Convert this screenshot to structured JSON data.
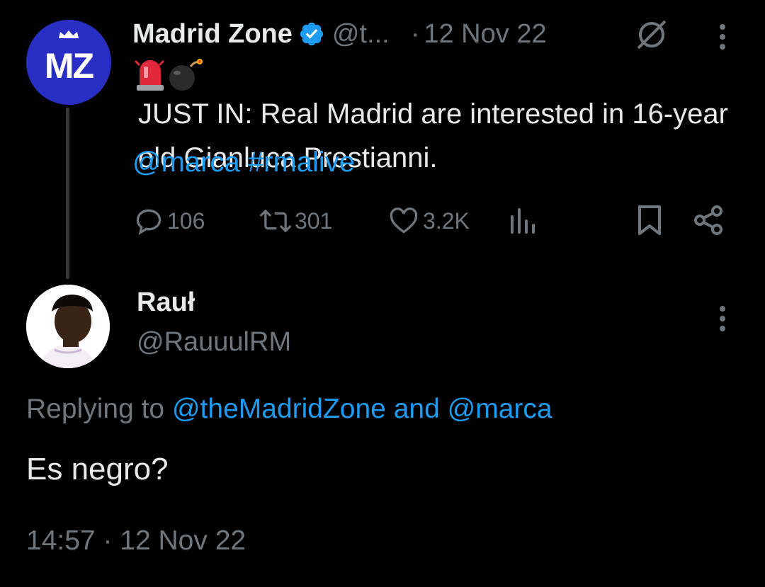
{
  "main_tweet": {
    "author_name": "Madrid Zone",
    "handle": "@t...",
    "separator": "·",
    "date": "12 Nov 22",
    "avatar_text": "MZ",
    "emojis": [
      "police-light",
      "bomb"
    ],
    "text": "JUST IN: Real Madrid are interested in 16-year old Gianluca Prestianni.",
    "mention": "@marca",
    "hashtag": "#rmalive",
    "replies": "106",
    "retweets": "301",
    "likes": "3.2K"
  },
  "reply": {
    "author_name": "Rauł",
    "handle": "@RauuulRM",
    "replying_prefix": "Replying to",
    "replying_to_1": "@theMadridZone",
    "replying_and": "and",
    "replying_to_2": "@marca",
    "text": "Es negro?",
    "time": "14:57",
    "separator": "·",
    "date": "12 Nov 22"
  },
  "colors": {
    "background": "#000000",
    "text": "#e7e9ea",
    "muted": "#71767b",
    "link": "#1d9bf0",
    "verified": "#1d9bf0",
    "mz_blue": "#2a2fc4"
  },
  "icons": [
    "verified-icon",
    "grok-icon",
    "more-icon",
    "reply-icon",
    "retweet-icon",
    "like-icon",
    "views-icon",
    "bookmark-icon",
    "share-icon"
  ]
}
